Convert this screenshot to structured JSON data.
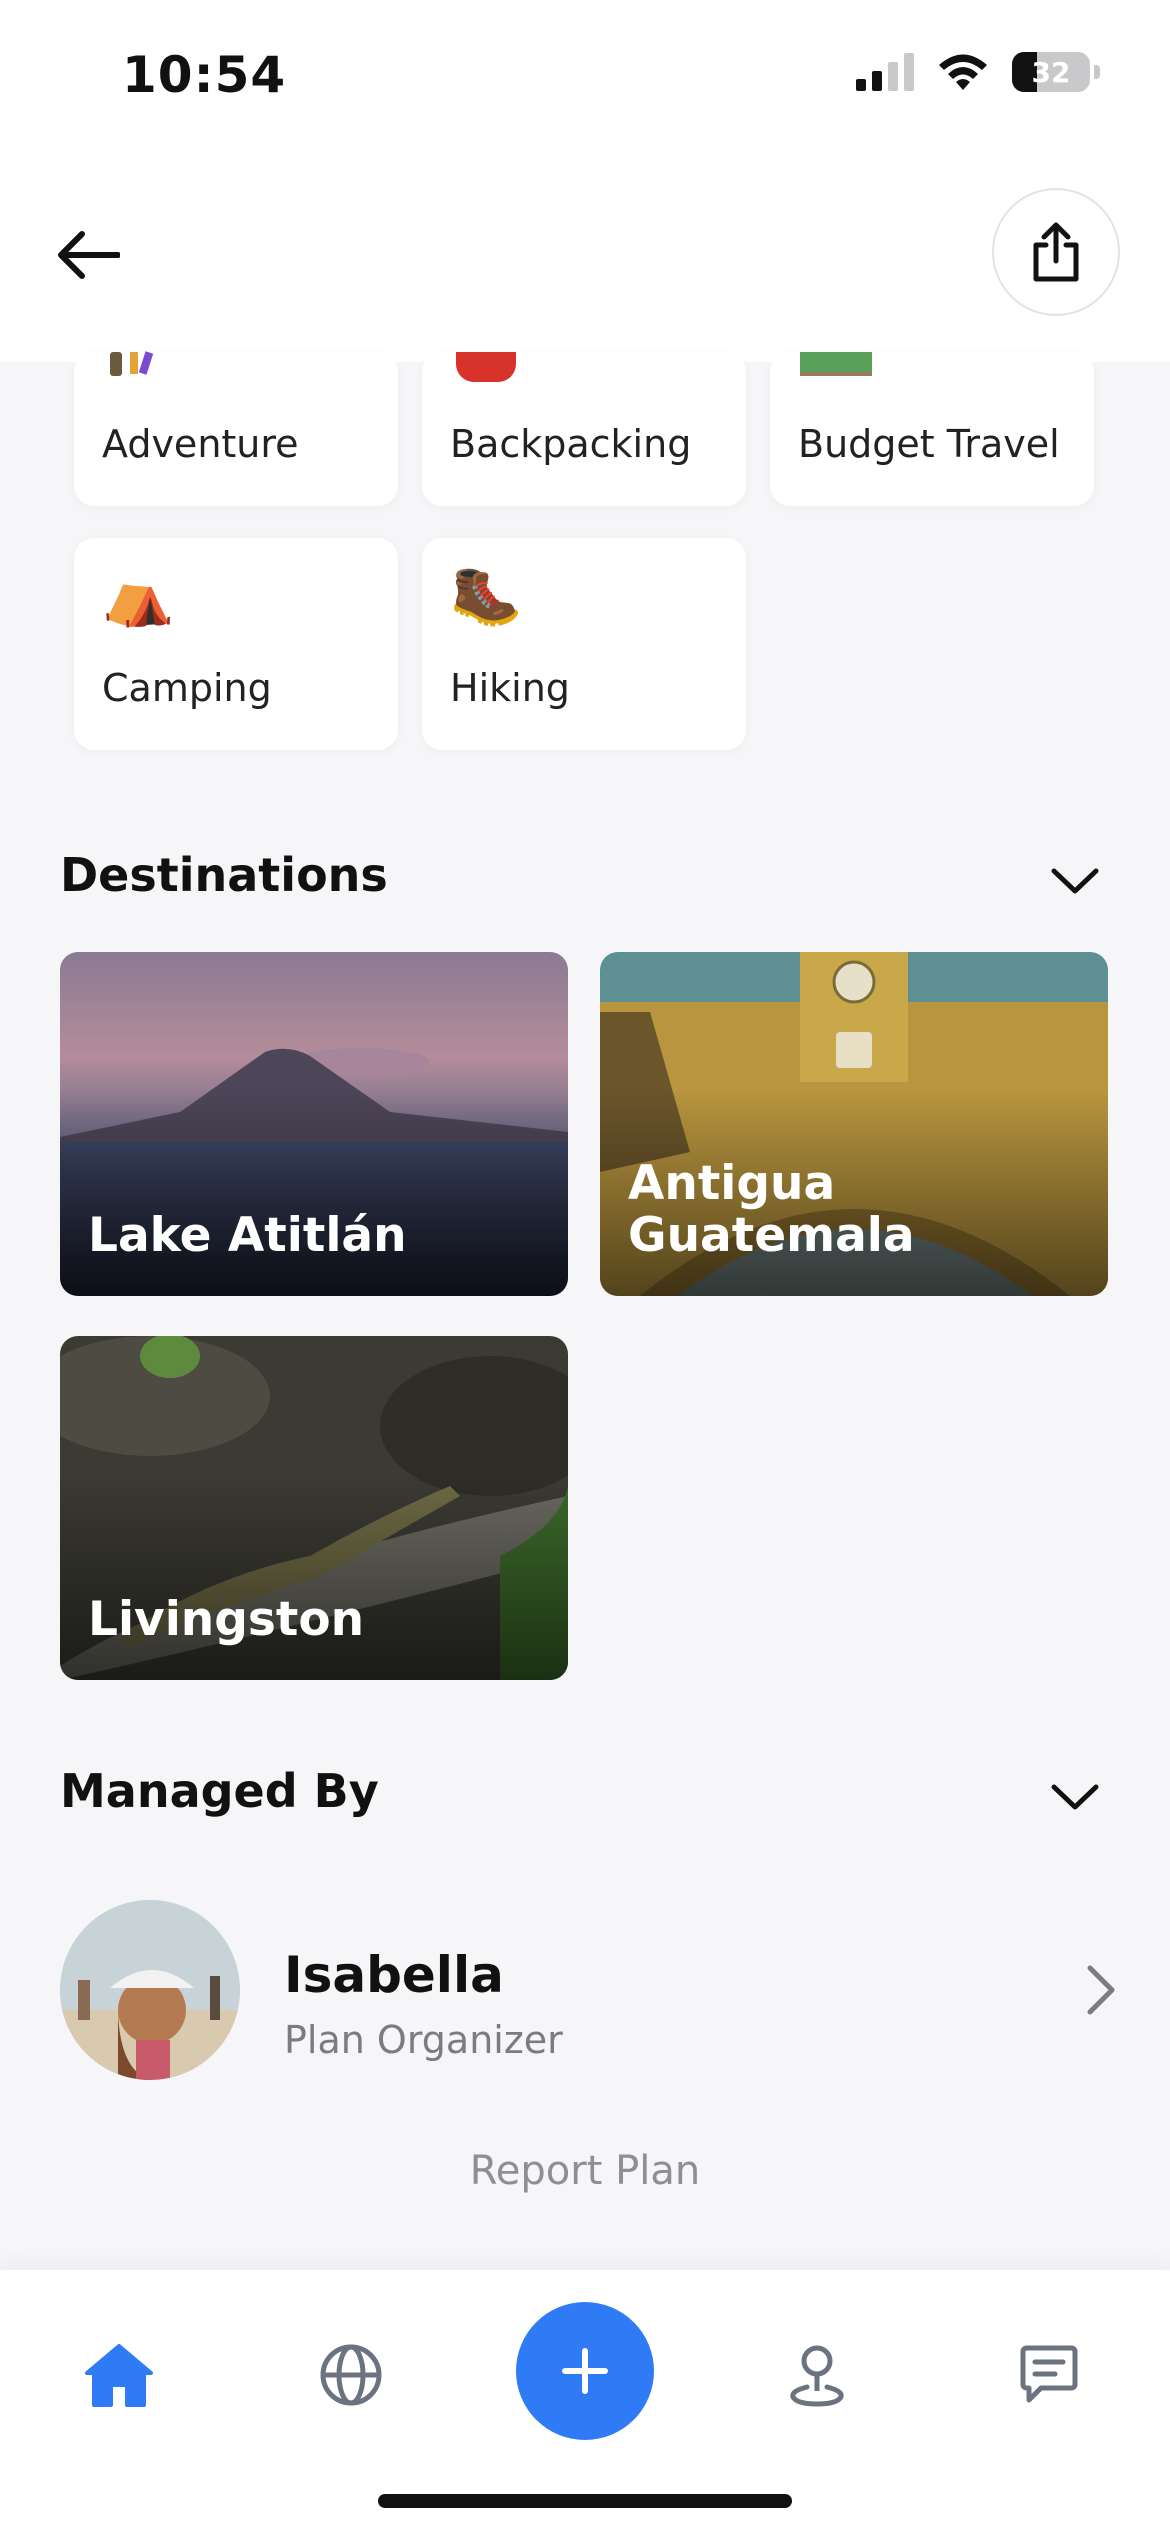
{
  "status_bar": {
    "time": "10:54",
    "battery": "32",
    "battery_level": 0.32
  },
  "interests": {
    "items": [
      {
        "label": "Adventure",
        "icon": "hiker-icon"
      },
      {
        "label": "Backpacking",
        "icon": "backpack-icon"
      },
      {
        "label": "Budget Travel",
        "icon": "money-icon"
      },
      {
        "label": "Camping",
        "emoji": "⛺",
        "icon": "tent-icon"
      },
      {
        "label": "Hiking",
        "emoji": "🥾",
        "icon": "hiking-boot-icon"
      }
    ]
  },
  "destinations": {
    "title": "Destinations",
    "items": [
      {
        "name": "Lake Atitlán"
      },
      {
        "name": "Antigua\nGuatemala"
      },
      {
        "name": "Livingston"
      }
    ]
  },
  "managed_by": {
    "title": "Managed By",
    "name": "Isabella",
    "role": "Plan Organizer"
  },
  "report": {
    "label": "Report Plan"
  },
  "colors": {
    "accent": "#2f7bf6",
    "icon_gray": "#6b7280"
  },
  "tab_icons": [
    "home-icon",
    "globe-icon",
    "plus-icon",
    "map-pin-icon",
    "chat-icon"
  ]
}
